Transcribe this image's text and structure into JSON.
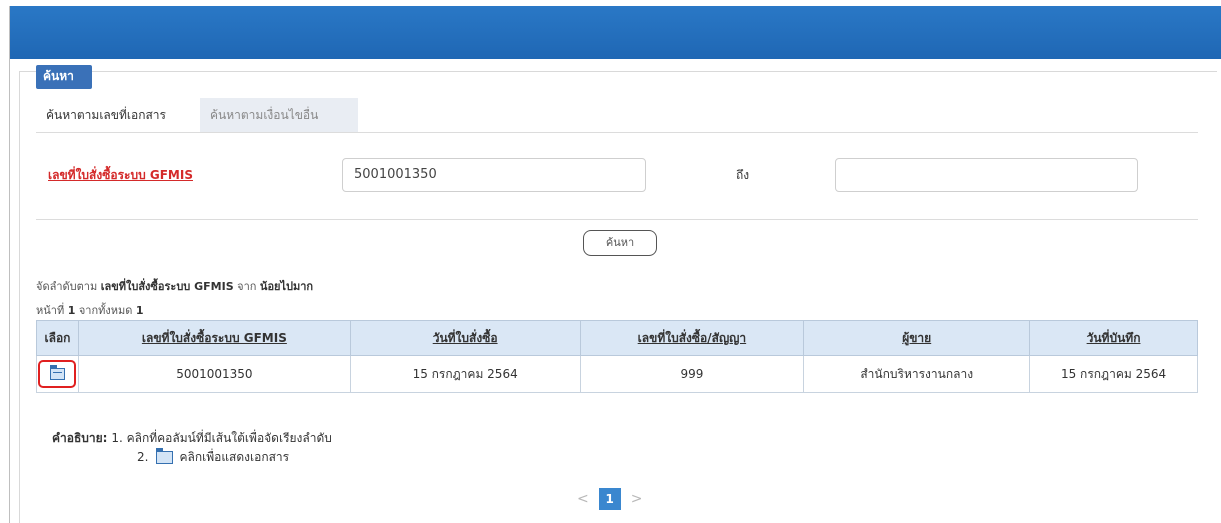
{
  "section": {
    "label": "ค้นหา"
  },
  "tabs": [
    {
      "label": "ค้นหาตามเลขที่เอกสาร"
    },
    {
      "label": "ค้นหาตามเงื่อนไขอื่น"
    }
  ],
  "search": {
    "field_label": "เลขที่ใบสั่งซื้อระบบ GFMIS",
    "from_value": "5001001350",
    "to_label": "ถึง",
    "to_value": "",
    "button_label": "ค้นหา"
  },
  "sort": {
    "prefix": "จัดลำดับตาม",
    "field": "เลขที่ใบสั่งซื้อระบบ GFMIS",
    "mid": "จาก",
    "order": "น้อยไปมาก"
  },
  "paging_info": {
    "prefix": "หน้าที่",
    "page": "1",
    "mid": "จากทั้งหมด",
    "total": "1"
  },
  "table": {
    "headers": [
      "เลือก",
      "เลขที่ใบสั่งซื้อระบบ GFMIS",
      "วันที่ใบสั่งซื้อ",
      "เลขที่ใบสั่งซื้อ/สัญญา",
      "ผู้ขาย",
      "วันที่บันทึก"
    ],
    "rows": [
      [
        "5001001350",
        "15 กรกฎาคม 2564",
        "999",
        "สำนักบริหารงานกลาง",
        "15 กรกฎาคม 2564"
      ]
    ]
  },
  "legend": {
    "title": "คำอธิบาย:",
    "item1": "1. คลิกที่คอลัมน์ที่มีเส้นใต้เพื่อจัดเรียงลำดับ",
    "item2_num": "2.",
    "item2_text": "คลิกเพื่อแสดงเอกสาร"
  },
  "pager": {
    "prev": "<",
    "current": "1",
    "next": ">"
  },
  "colors": {
    "topbar": "#1f67b4",
    "accent": "#3a71b8",
    "required": "#d42a2a",
    "header_bg": "#dae7f5",
    "highlight": "#e02020"
  }
}
